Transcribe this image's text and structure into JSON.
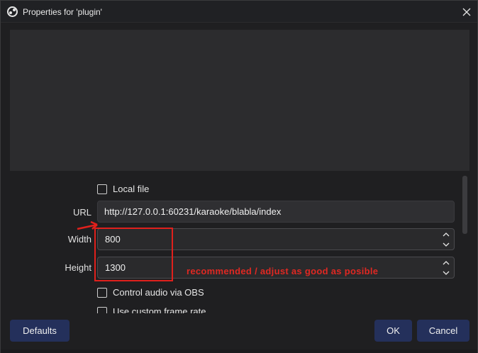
{
  "window": {
    "title": "Properties for 'plugin'",
    "icon": "obs-icon"
  },
  "form": {
    "local_file_label": "Local file",
    "url_label": "URL",
    "url_value": "http://127.0.0.1:60231/karaoke/blabla/index",
    "width_label": "Width",
    "width_value": "800",
    "height_label": "Height",
    "height_value": "1300",
    "control_audio_label": "Control audio via OBS",
    "custom_frame_rate_label": "Use custom frame rate"
  },
  "annotation": {
    "note": "recommended / adjust as good as posible",
    "color": "#e0201c"
  },
  "buttons": {
    "defaults": "Defaults",
    "ok": "OK",
    "cancel": "Cancel"
  },
  "colors": {
    "button_bg": "#24305b",
    "window_bg": "#1f1f21"
  }
}
